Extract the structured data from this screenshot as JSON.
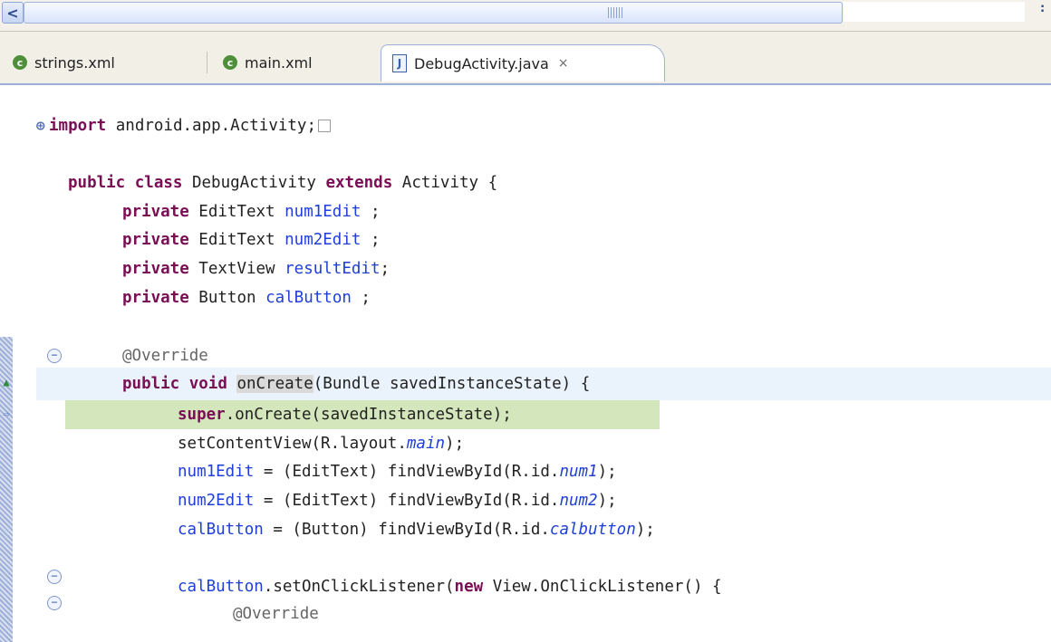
{
  "tabs": [
    {
      "label": "strings.xml",
      "icon": "xml-file-icon"
    },
    {
      "label": "main.xml",
      "icon": "xml-file-icon"
    },
    {
      "label": "DebugActivity.java",
      "icon": "java-file-icon",
      "active": true
    }
  ],
  "icons": {
    "xml_glyph": "c",
    "java_glyph": "J",
    "close_glyph": "×",
    "scroll_left": "<",
    "scroll_right": ":",
    "fold_plus": "⊕",
    "fold_minus": "⊖",
    "debug_current_frame": "▲",
    "debug_instruction_pointer": "⇨"
  },
  "code": {
    "import_kw": "import",
    "import_rest": " android.app.Activity;",
    "class_kw1": "public class",
    "class_name": " DebugActivity ",
    "class_kw2": "extends",
    "class_rest": " Activity {",
    "f1_kw": "private",
    "f1_type": " EditText ",
    "f1_name": "num1Edit",
    "f1_end": " ;",
    "f2_kw": "private",
    "f2_type": " EditText ",
    "f2_name": "num2Edit",
    "f2_end": " ;",
    "f3_kw": "private",
    "f3_type": " TextView ",
    "f3_name": "resultEdit",
    "f3_end": ";",
    "f4_kw": "private",
    "f4_type": " Button ",
    "f4_name": "calButton",
    "f4_end": " ;",
    "override1": "@Override",
    "m_kw": "public void",
    "m_sp": " ",
    "m_name": "onCreate",
    "m_rest": "(Bundle savedInstanceState) {",
    "super_kw": "super",
    "super_rest": ".onCreate(savedInstanceState);",
    "scv_a": "setContentView(R.layout.",
    "scv_b": "main",
    "scv_c": ");",
    "n1_a": "num1Edit",
    "n1_b": " = (EditText) findViewById(R.id.",
    "n1_c": "num1",
    "n1_d": ");",
    "n2_a": "num2Edit",
    "n2_b": " = (EditText) findViewById(R.id.",
    "n2_c": "num2",
    "n2_d": ");",
    "cb_a": "calButton",
    "cb_b": " = (Button) findViewById(R.id.",
    "cb_c": "calbutton",
    "cb_d": ");",
    "l_a": "calButton",
    "l_b": ".setOnClickListener(",
    "l_c": "new",
    "l_d": " View.OnClickListener() {",
    "override2": "@Override"
  }
}
